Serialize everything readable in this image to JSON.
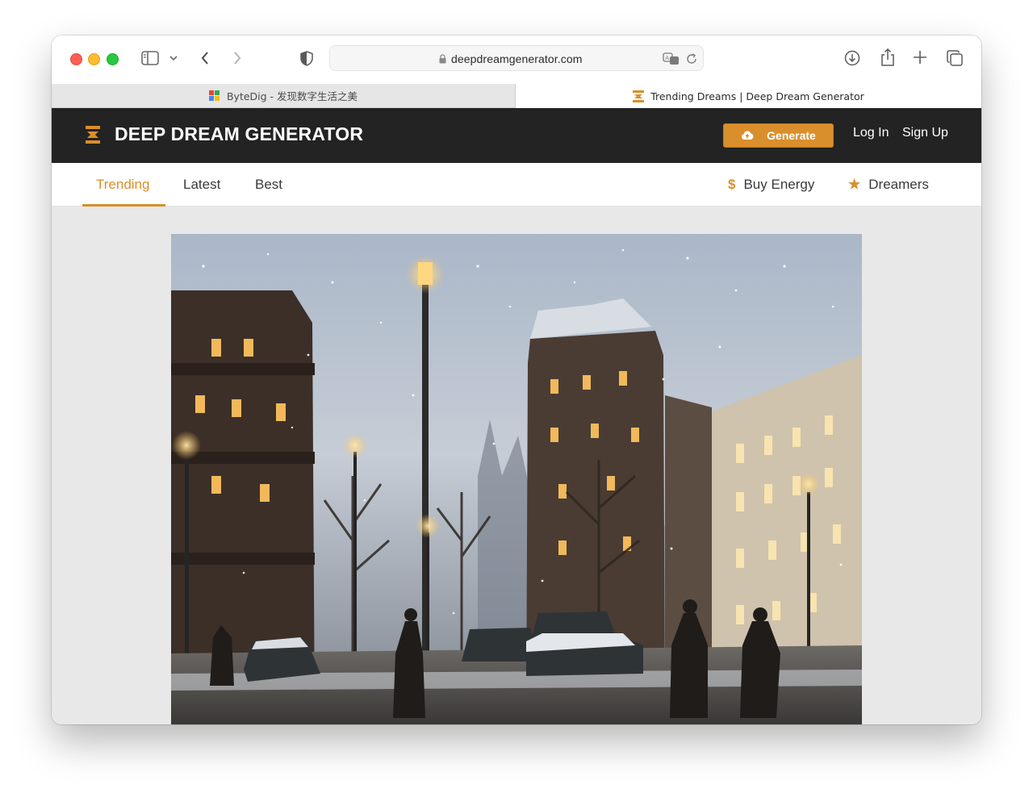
{
  "browser": {
    "address": "deepdreamgenerator.com",
    "tabs": [
      {
        "title": "ByteDig - 发现数字生活之美",
        "active": false
      },
      {
        "title": "Trending Dreams | Deep Dream Generator",
        "active": true
      }
    ]
  },
  "site": {
    "brand": "DEEP DREAM GENERATOR",
    "generate_label": "Generate",
    "login_label": "Log In",
    "signup_label": "Sign Up",
    "accent_color": "#d98f2b",
    "header_color": "#232323"
  },
  "subnav": {
    "tabs": [
      {
        "label": "Trending",
        "active": true
      },
      {
        "label": "Latest",
        "active": false
      },
      {
        "label": "Best",
        "active": false
      }
    ],
    "buy_energy_icon": "$",
    "buy_energy_label": "Buy Energy",
    "dreamers_icon": "★",
    "dreamers_label": "Dreamers"
  },
  "feed": {
    "artwork_icon": "snowy-city-street-painting"
  }
}
